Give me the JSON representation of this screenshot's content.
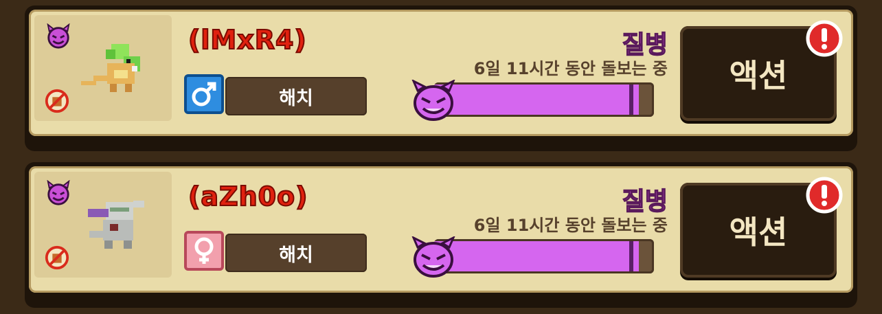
{
  "cards": [
    {
      "name": "(lMxR4)",
      "gender": "male",
      "gender_symbol": "♂",
      "stage": "해치",
      "status_title": "질병",
      "status_sub": "6일 11시간 동안 돌보는 중",
      "progress": 0.93,
      "action_label": "액션",
      "alert_symbol": "!",
      "pet_icon": "green-lizard-pet-icon"
    },
    {
      "name": "(aZh0o)",
      "gender": "female",
      "gender_symbol": "♀",
      "stage": "해치",
      "status_title": "질병",
      "status_sub": "6일 11시간 동안 돌보는 중",
      "progress": 0.93,
      "action_label": "액션",
      "alert_symbol": "!",
      "pet_icon": "armored-dragon-pet-icon"
    }
  ],
  "colors": {
    "name": "#e0210f",
    "status": "#e659e8",
    "bar_fill": "#d566ef",
    "male": "#2e8de0",
    "female": "#f2a0ad"
  }
}
